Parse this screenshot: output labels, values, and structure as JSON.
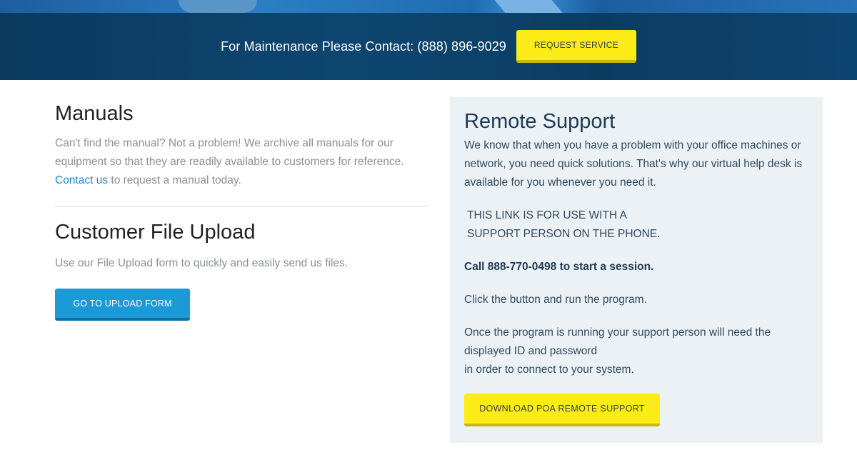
{
  "banner": {
    "contact_text": "For Maintenance Please Contact: (888) 896-9029",
    "request_button": "REQUEST SERVICE"
  },
  "manuals": {
    "title": "Manuals",
    "text_before_link": "Can't find the manual? Not a problem! We archive all manuals for our equipment so that they are readily available to customers for reference.",
    "link_text": "Contact us",
    "text_after_link": " to request a manual today."
  },
  "upload": {
    "title": "Customer File Upload",
    "text": "Use our File Upload form to quickly and easily send us files.",
    "button": "GO TO UPLOAD FORM"
  },
  "remote": {
    "title": "Remote Support",
    "intro": "We know that when you have a problem with your office machines or network, you need quick solutions. That's why our virtual help desk is available for you whenever you need it.",
    "note_line1": "THIS LINK IS FOR USE WITH A",
    "note_line2": "SUPPORT PERSON ON THE PHONE.",
    "call": "Call 888-770-0498 to start a session.",
    "click": "Click the button and run the program.",
    "once_line1": "Once the program is running your support person will need the displayed ID and password",
    "once_line2": "in order to connect to your system.",
    "download_button": "DOWNLOAD POA REMOTE SUPPORT"
  },
  "colors": {
    "banner_bg": "#0b3d63",
    "yellow_button": "#fbec17",
    "blue_button": "#1a9ad6",
    "panel_bg": "#ecf1f5",
    "link": "#1d89c5"
  }
}
